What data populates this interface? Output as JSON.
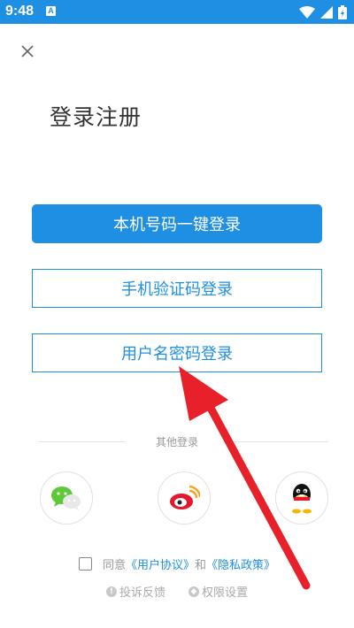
{
  "status_bar": {
    "time": "9:48",
    "notification_letter": "A"
  },
  "page": {
    "title": "登录注册"
  },
  "buttons": {
    "one_click": "本机号码一键登录",
    "sms": "手机验证码登录",
    "username": "用户名密码登录"
  },
  "other_login": {
    "label": "其他登录",
    "providers": [
      "wechat-icon",
      "weibo-icon",
      "qq-icon"
    ]
  },
  "agreement": {
    "prefix": "同意",
    "user_agreement": "《用户协议》",
    "and": "和",
    "privacy_policy": "《隐私政策》"
  },
  "footer": {
    "complaint": "投诉反馈",
    "permission": "权限设置"
  },
  "colors": {
    "accent": "#1f8fe3",
    "arrow": "#e8202a"
  }
}
